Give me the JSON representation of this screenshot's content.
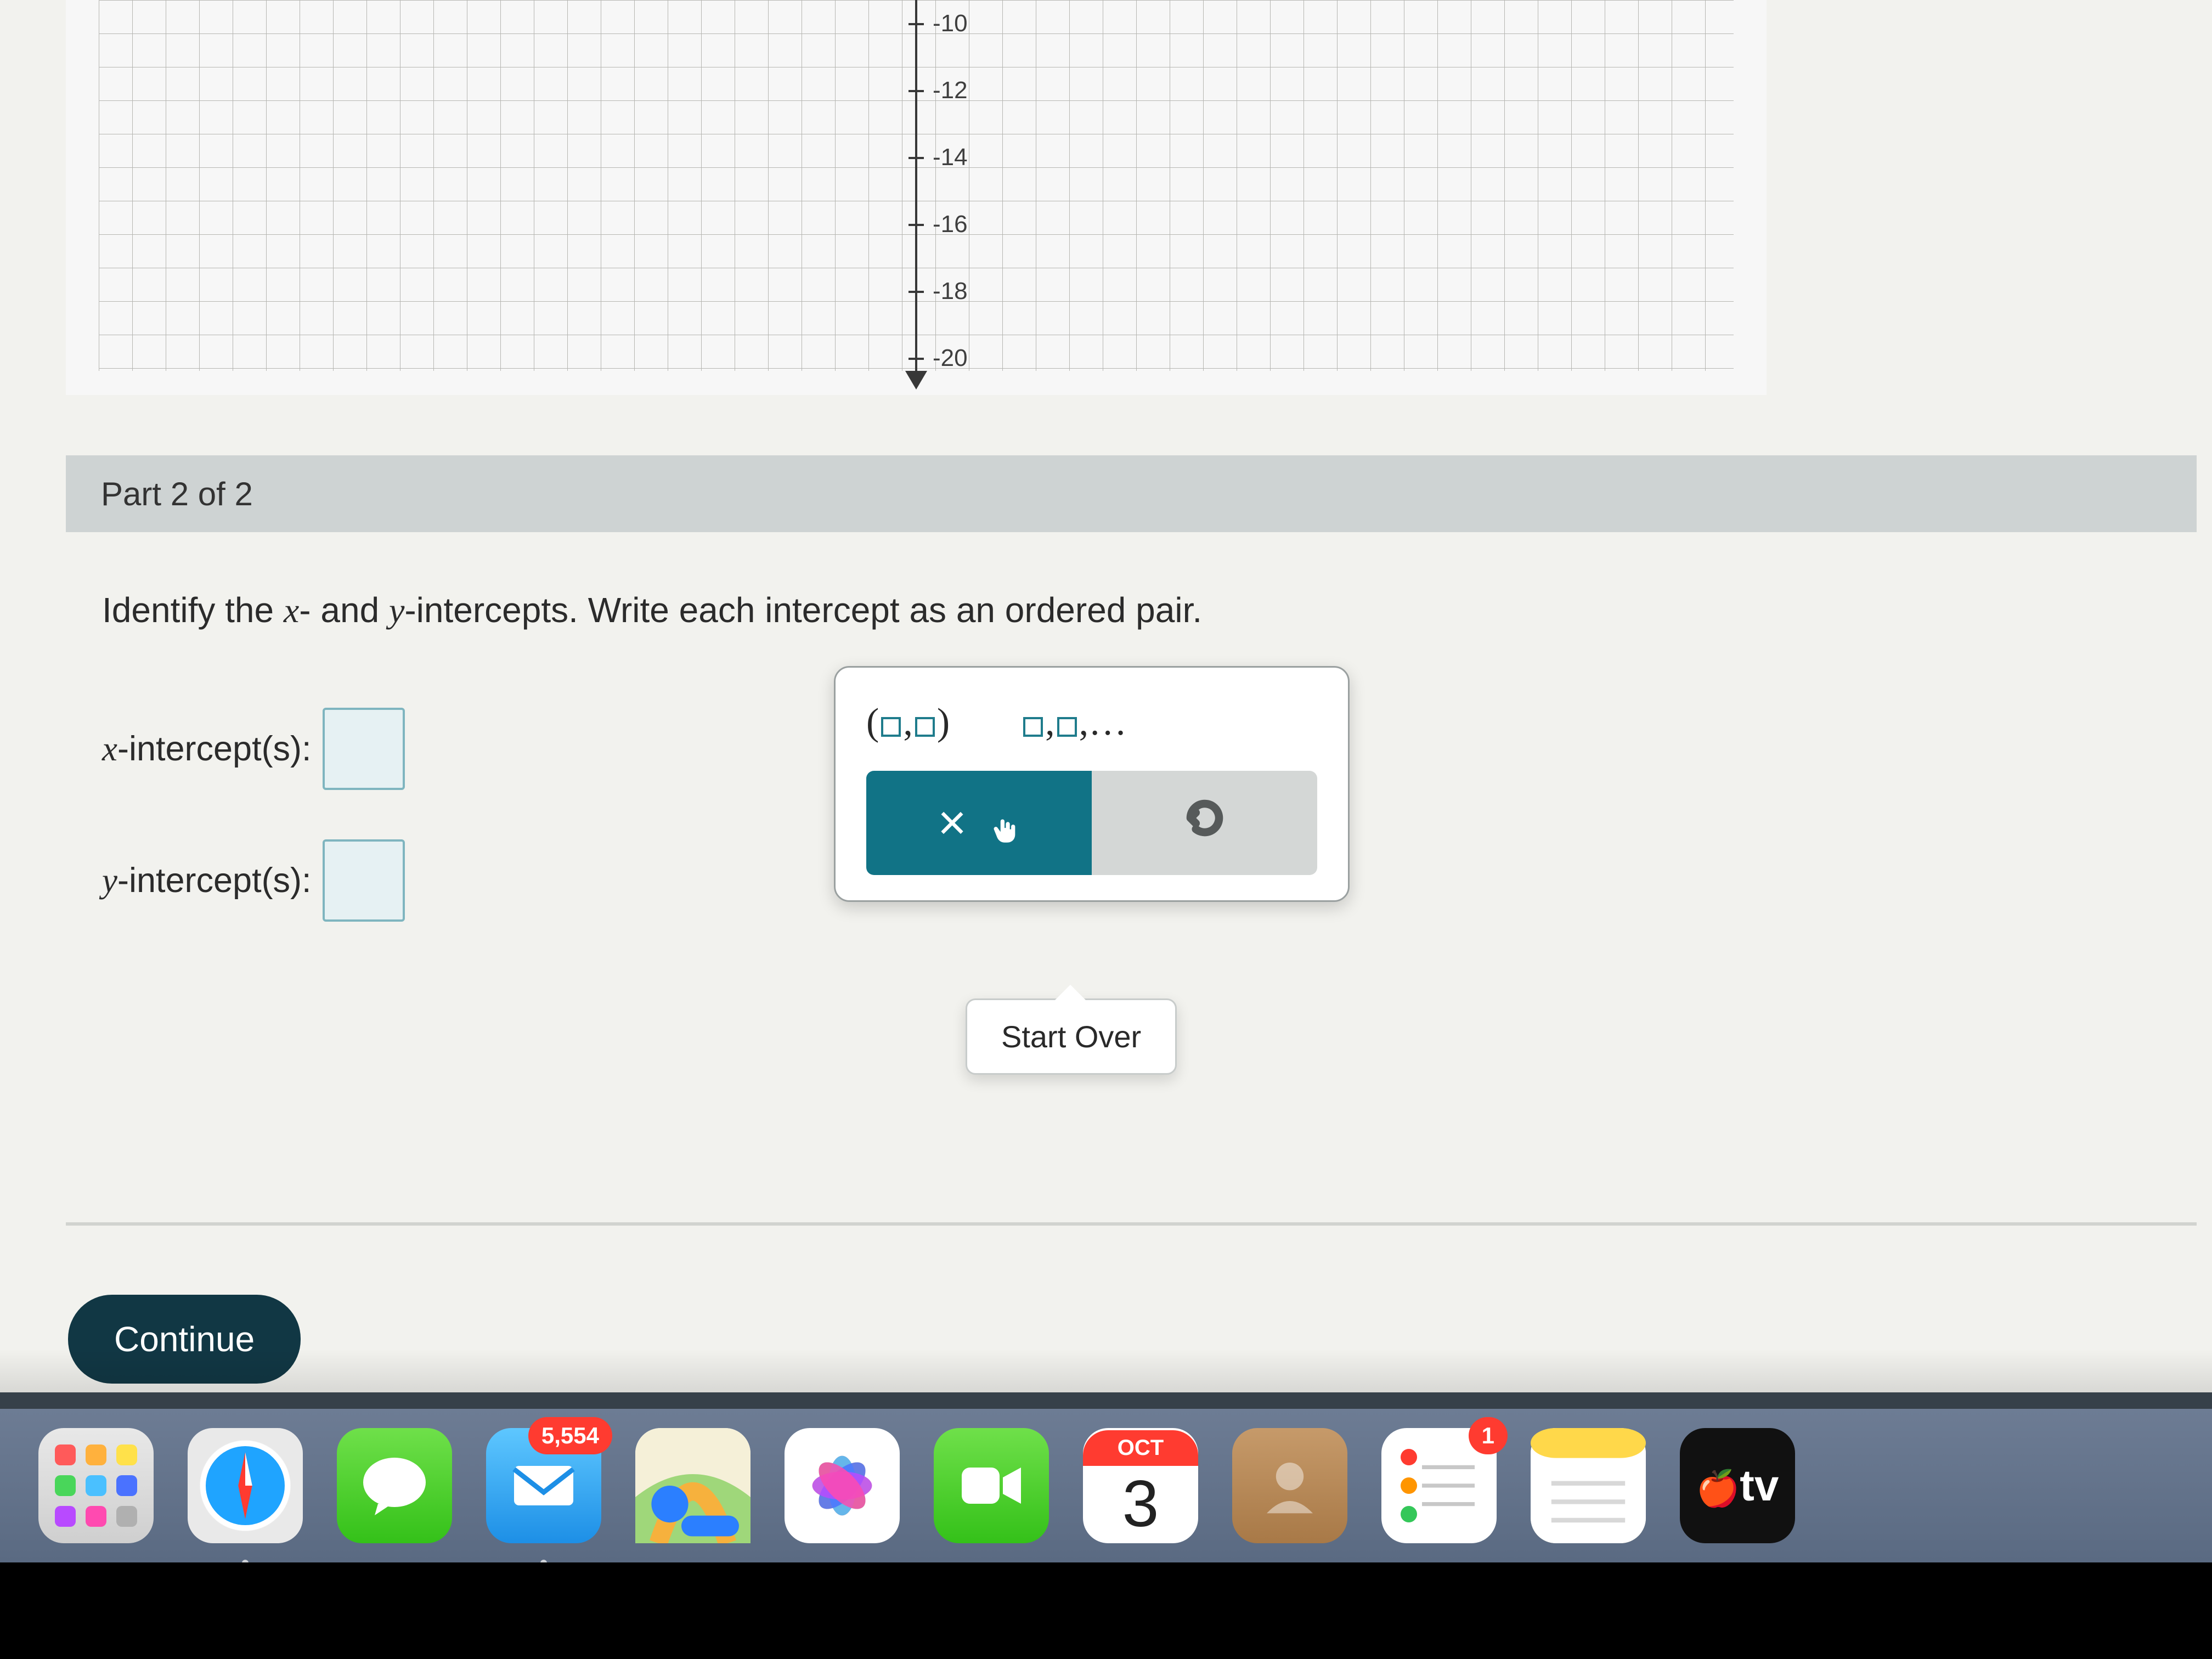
{
  "graph": {
    "tick_labels": [
      "-10",
      "-12",
      "-14",
      "-16",
      "-18",
      "-20"
    ]
  },
  "part_header": "Part 2 of 2",
  "question_prefix": "Identify the ",
  "question_x": "x",
  "question_mid": "- and ",
  "question_y": "y",
  "question_suffix": "-intercepts.  Write each intercept as an ordered pair.",
  "x_label_var": "x",
  "x_label_rest": "-intercept(s):",
  "y_label_var": "y",
  "y_label_rest": "-intercept(s):",
  "palette": {
    "ordered_pair": "(□,□)",
    "list": "□,□,…",
    "clear": "×",
    "tooltip": "Start Over"
  },
  "continue": "Continue",
  "dock": {
    "mail_badge": "5,554",
    "reminders_badge": "1",
    "calendar_month": "OCT",
    "calendar_day": "3",
    "tv": "tv"
  }
}
